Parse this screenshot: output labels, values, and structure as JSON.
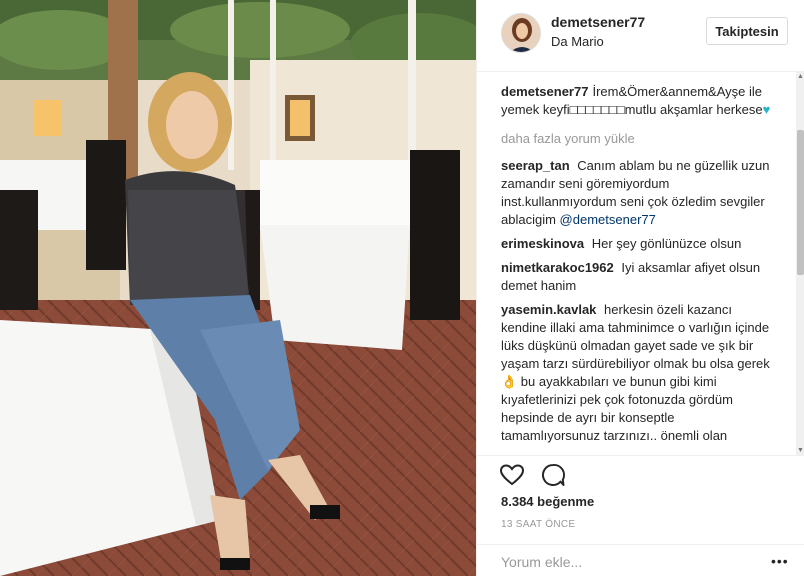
{
  "post": {
    "username": "demetsener77",
    "location": "Da Mario",
    "follow_label": "Takiptesin"
  },
  "caption": {
    "user": "demetsener77",
    "text": "İrem&Ömer&annem&Ayşe ile yemek keyfi□□□□□□□mutlu akşamlar herkese",
    "emoji": "♥"
  },
  "load_more_label": "daha fazla yorum yükle",
  "comments": [
    {
      "user": "seerap_tan",
      "text": "Canım ablam bu ne güzellik uzun zamandır seni göremiyordum inst.kullanmıyordum seni çok özledim sevgiler ablacigim",
      "mention": "@demetsener77"
    },
    {
      "user": "erimeskinova",
      "text": "Her şey gönlünüzce olsun"
    },
    {
      "user": "nimetkarakoc1962",
      "text": "Iyi aksamlar afiyet olsun demet hanim"
    },
    {
      "user": "yasemin.kavlak",
      "text": "herkesin özeli kazancı kendine illaki ama tahminimce o varlığın içinde lüks düşkünü olmadan gayet sade ve şık bir yaşam tarzı sürdürebiliyor olmak bu olsa gerek👌 bu ayakkabıları ve bunun gibi kimi kıyafetlerinizi pek çok fotonuzda gördüm hepsinde de ayrı bir konseptle tamamlıyorsunuz tarzınızı.. önemli olan"
    }
  ],
  "likes": "8.384 beğenme",
  "timestamp": "13 SAAT ÖNCE",
  "comment_input": {
    "placeholder": "Yorum ekle..."
  },
  "icons": {
    "like": "heart-icon",
    "comment": "comment-bubble-icon",
    "more": "more-options-icon"
  }
}
